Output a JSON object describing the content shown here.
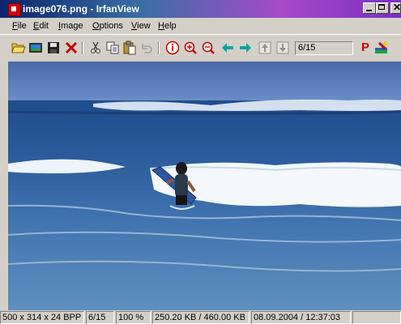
{
  "window": {
    "title": "image076.png - IrfanView",
    "controls": {
      "minimize": "minimize",
      "maximize": "maximize",
      "close": "close"
    }
  },
  "menu": {
    "items": [
      {
        "label": "File",
        "mnemonic": "F"
      },
      {
        "label": "Edit",
        "mnemonic": "E"
      },
      {
        "label": "Image",
        "mnemonic": "I"
      },
      {
        "label": "Options",
        "mnemonic": "O"
      },
      {
        "label": "View",
        "mnemonic": "V"
      },
      {
        "label": "Help",
        "mnemonic": "H"
      }
    ]
  },
  "toolbar": {
    "icons": [
      "open-folder-icon",
      "slideshow-icon",
      "save-icon",
      "delete-icon",
      "cut-icon",
      "copy-icon",
      "paste-icon",
      "undo-icon",
      "info-icon",
      "zoom-in-icon",
      "zoom-out-icon",
      "previous-icon",
      "next-icon",
      "first-icon",
      "last-icon",
      "print-icon",
      "paint-icon"
    ],
    "page_value": "6/15",
    "print_label": "P"
  },
  "status": {
    "dimensions": "500 x 314 x 24 BPP",
    "position": "6/15",
    "zoom": "100 %",
    "filesize": "250.20 KB / 460.00 KB",
    "datetime": "08.09.2004 / 12:37:03"
  },
  "colors": {
    "chrome": "#d4d0c8",
    "title_start": "#0a246a",
    "title_end": "#7b2fbf",
    "accent_red": "#d40000"
  }
}
